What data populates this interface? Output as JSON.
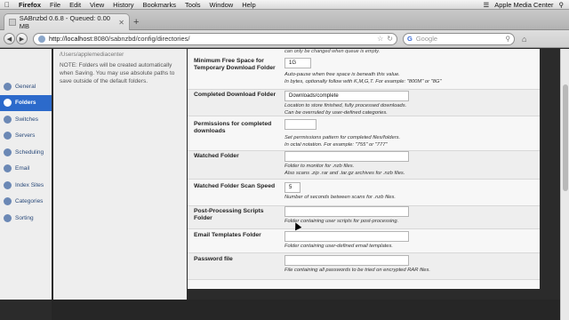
{
  "menubar": {
    "app": "Firefox",
    "items": [
      "File",
      "Edit",
      "View",
      "History",
      "Bookmarks",
      "Tools",
      "Window",
      "Help"
    ],
    "right_label": "Apple Media Center"
  },
  "tab": {
    "title": "SABnzbd 0.6.8 - Queued: 0.00 MB"
  },
  "navbar": {
    "url_host": "http://localhost",
    "url_path": ":8080/sabnzbd/config/directories/",
    "search_placeholder": "Google"
  },
  "sidebar": {
    "items": [
      {
        "label": "General",
        "active": false
      },
      {
        "label": "Folders",
        "active": true
      },
      {
        "label": "Switches",
        "active": false
      },
      {
        "label": "Servers",
        "active": false
      },
      {
        "label": "Scheduling",
        "active": false
      },
      {
        "label": "Email",
        "active": false
      },
      {
        "label": "Index Sites",
        "active": false
      },
      {
        "label": "Categories",
        "active": false
      },
      {
        "label": "Sorting",
        "active": false
      }
    ]
  },
  "help": {
    "path": "/Users/applemediacenter",
    "note": "NOTE: Folders will be created automatically when Saving. You may use absolute paths to save outside of the default folders."
  },
  "form": {
    "top_note": "can only be changed when queue is empty.",
    "fields": [
      {
        "label": "Minimum Free Space for Temporary Download Folder",
        "value": "1G",
        "desc1": "Auto-pause when free space is beneath this value.",
        "desc2": "In bytes, optionally follow with K,M,G,T. For example: \"800M\" or \"8G\""
      },
      {
        "label": "Completed Download Folder",
        "value": "Downloads/complete",
        "desc1": "Location to store finished, fully processed downloads.",
        "desc2": "Can be overruled by user-defined categories."
      },
      {
        "label": "Permissions for completed downloads",
        "value": "",
        "desc1": "Set permissions pattern for completed files/folders.",
        "desc2": "In octal notation. For example: \"755\" or \"777\""
      },
      {
        "label": "Watched Folder",
        "value": "",
        "desc1": "Folder to monitor for .nzb files.",
        "desc2": "Also scans .zip .rar and .tar.gz archives for .nzb files."
      },
      {
        "label": "Watched Folder Scan Speed",
        "value": "5",
        "desc1": "Number of seconds between scans for .nzb files.",
        "desc2": ""
      },
      {
        "label": "Post-Processing Scripts Folder",
        "value": "",
        "desc1": "Folder containing user scripts for post-processing.",
        "desc2": ""
      },
      {
        "label": "Email Templates Folder",
        "value": "",
        "desc1": "Folder containing user-defined email templates.",
        "desc2": ""
      },
      {
        "label": "Password file",
        "value": "",
        "desc1": "File containing all passwords to be tried on encrypted RAR files.",
        "desc2": ""
      }
    ]
  }
}
